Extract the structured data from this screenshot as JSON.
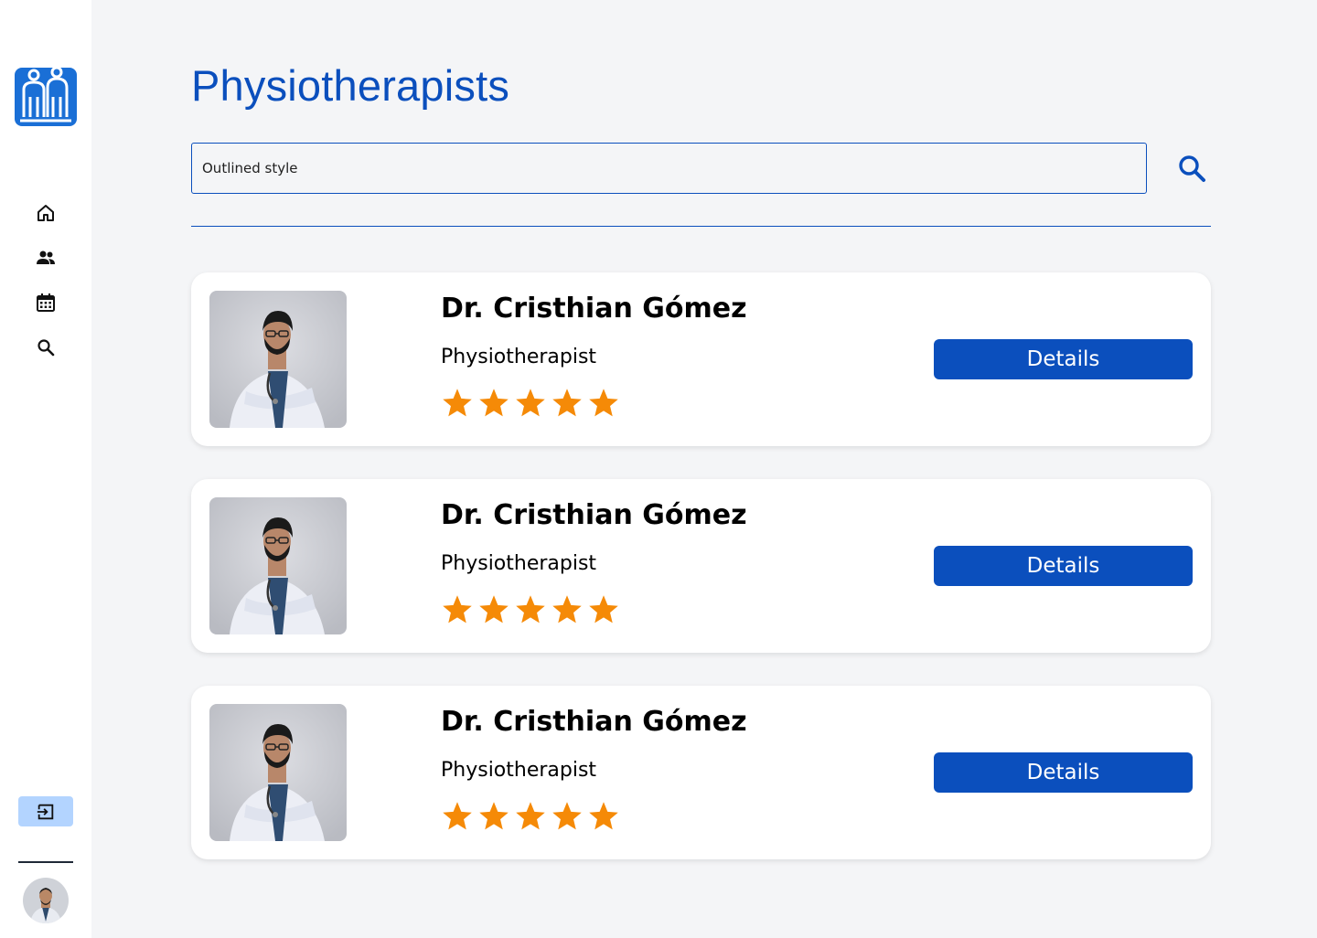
{
  "page": {
    "title": "Physiotherapists"
  },
  "search": {
    "placeholder": "Outlined style",
    "value": "Outlined style"
  },
  "nav": {
    "items": [
      {
        "icon": "home-icon"
      },
      {
        "icon": "people-icon"
      },
      {
        "icon": "calendar-icon"
      },
      {
        "icon": "search-icon"
      }
    ]
  },
  "cards": [
    {
      "name": "Dr. Cristhian Gómez",
      "role": "Physiotherapist",
      "rating": 5,
      "button": "Details"
    },
    {
      "name": "Dr. Cristhian Gómez",
      "role": "Physiotherapist",
      "rating": 5,
      "button": "Details"
    },
    {
      "name": "Dr. Cristhian Gómez",
      "role": "Physiotherapist",
      "rating": 5,
      "button": "Details"
    }
  ],
  "colors": {
    "brand": "#0b4fbd",
    "star": "#f58a07",
    "background": "#f4f5f7",
    "logout_bg": "#b3d4ff"
  }
}
